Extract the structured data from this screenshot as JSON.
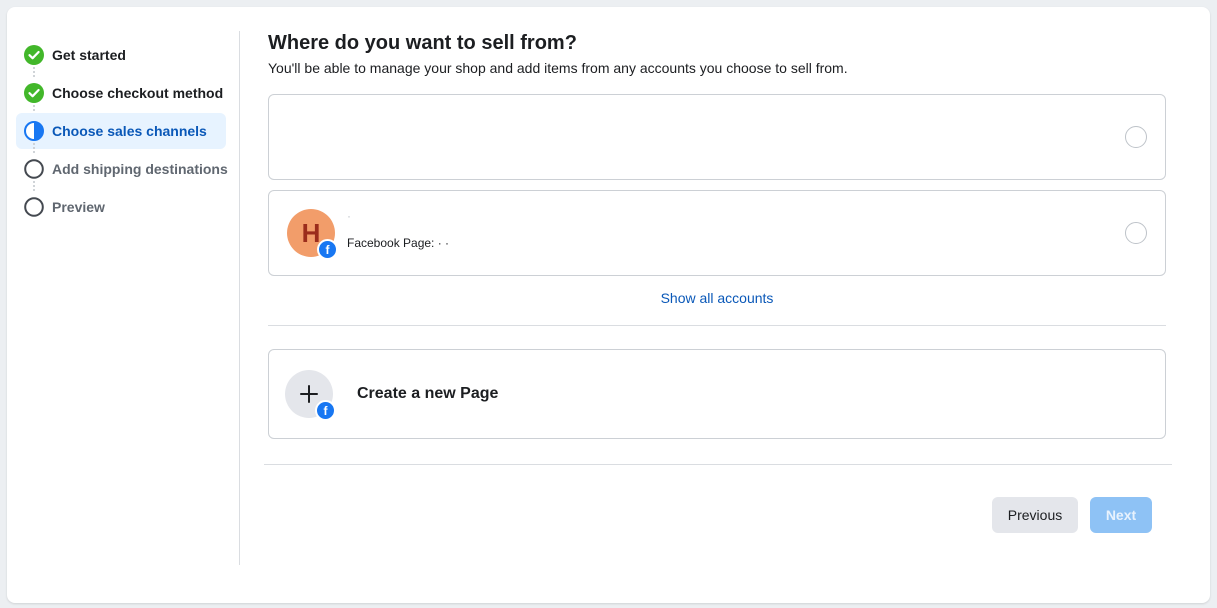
{
  "steps": [
    {
      "label": "Get started",
      "status": "done"
    },
    {
      "label": "Choose checkout method",
      "status": "done"
    },
    {
      "label": "Choose sales channels",
      "status": "active"
    },
    {
      "label": "Add shipping destinations",
      "status": "todo"
    },
    {
      "label": "Preview",
      "status": "todo"
    }
  ],
  "main": {
    "title": "Where do you want to sell from?",
    "subtitle": "You'll be able to manage your shop and add items from any accounts you choose to sell from."
  },
  "accounts": [
    {
      "name": "",
      "subtitle": ""
    },
    {
      "avatar_letter": "H",
      "name": "·",
      "subtitle": "Facebook Page:  · ·"
    }
  ],
  "show_all_label": "Show all accounts",
  "create_page_label": "Create a new Page",
  "buttons": {
    "previous": "Previous",
    "next": "Next"
  },
  "icons": {
    "step_done": "check-circle-icon",
    "step_active": "half-circle-icon",
    "step_todo": "empty-circle-icon",
    "badge": "facebook-icon",
    "add": "plus-icon"
  },
  "colors": {
    "done": "#42b72a",
    "active": "#1877f2",
    "link": "#0a58b8",
    "next_disabled": "#8ec2f5"
  }
}
